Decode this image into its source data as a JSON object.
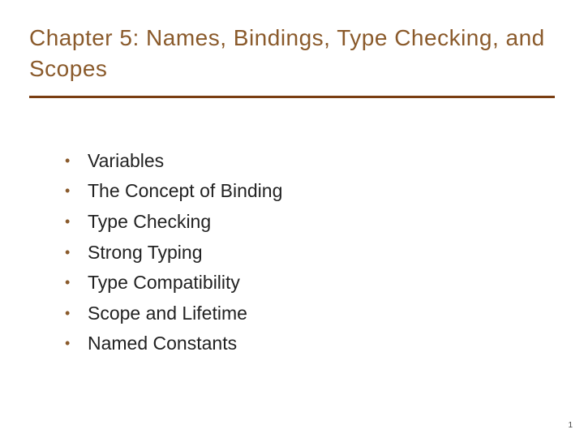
{
  "title": "Chapter 5: Names, Bindings, Type Checking, and Scopes",
  "bullets": [
    "Variables",
    "The Concept of Binding",
    "Type Checking",
    "Strong Typing",
    "Type Compatibility",
    "Scope and Lifetime",
    "Named Constants"
  ],
  "page_number": "1"
}
